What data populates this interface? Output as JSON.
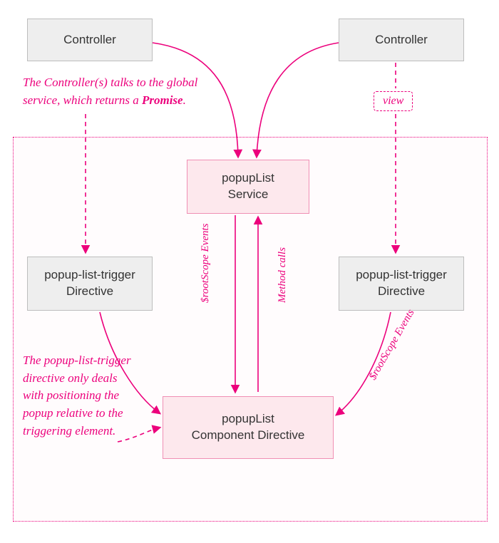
{
  "boxes": {
    "controllerLeft": "Controller",
    "controllerRight": "Controller",
    "view": "view",
    "service": "popupList\nService",
    "triggerLeft": "popup-list-trigger\nDirective",
    "triggerRight": "popup-list-trigger\nDirective",
    "component": "popupList\nComponent Directive"
  },
  "notes": {
    "controllerService": {
      "pre": "The Controller(s) talks to the global service, which returns a ",
      "bold": "Promise",
      "post": "."
    },
    "triggerPositioning": "The\npopup-list-trigger\ndirective only deals\nwith positioning\nthe popup relative\nto the triggering\nelement."
  },
  "edgeLabels": {
    "rootscopeMid": "$rootScope Events",
    "methodCalls": "Method calls",
    "rootscopeRight": "$rootScope Events"
  },
  "colors": {
    "accent": "#ec007c",
    "greyFill": "#eeeeee",
    "greyBorder": "#bdbdbd",
    "pinkFill": "#fde8ed",
    "pinkBorder": "#f08fb4"
  },
  "arrows": [
    {
      "id": "arrow-controller-left-to-service",
      "style": "solid",
      "from": "controllerLeft",
      "to": "service"
    },
    {
      "id": "arrow-controller-right-to-service",
      "style": "solid",
      "from": "controllerRight",
      "to": "service"
    },
    {
      "id": "arrow-controller-left-to-trigger-left",
      "style": "dashed",
      "from": "controllerLeft",
      "to": "triggerLeft"
    },
    {
      "id": "arrow-controller-right-to-view",
      "style": "dashed",
      "from": "controllerRight",
      "to": "view"
    },
    {
      "id": "arrow-view-to-trigger-right",
      "style": "dashed",
      "from": "view",
      "to": "triggerRight"
    },
    {
      "id": "arrow-service-to-component",
      "style": "solid",
      "from": "service",
      "to": "component",
      "label": "$rootScope Events"
    },
    {
      "id": "arrow-component-to-service",
      "style": "solid",
      "from": "component",
      "to": "service",
      "label": "Method calls"
    },
    {
      "id": "arrow-trigger-left-to-component",
      "style": "solid",
      "from": "triggerLeft",
      "to": "component"
    },
    {
      "id": "arrow-trigger-right-to-component",
      "style": "solid",
      "from": "triggerRight",
      "to": "component",
      "label": "$rootScope Events"
    },
    {
      "id": "arrow-note-to-component",
      "style": "dashed",
      "from": "note-trigger-positioning",
      "to": "component"
    }
  ]
}
